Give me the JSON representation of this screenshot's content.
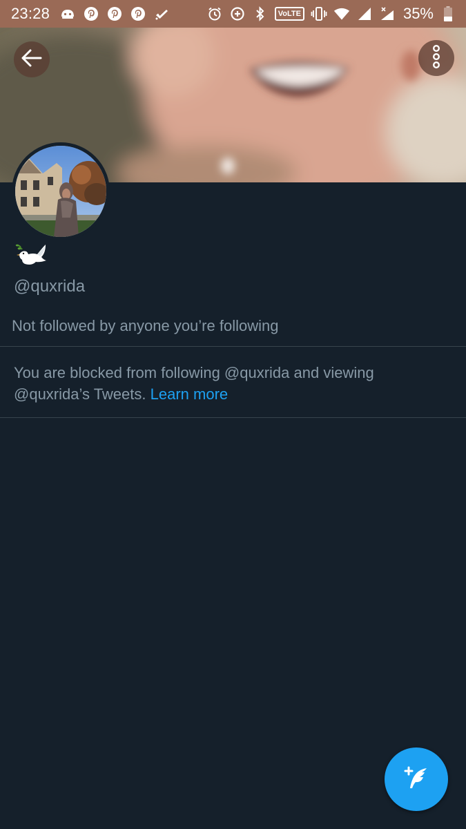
{
  "status_bar": {
    "time": "23:28",
    "left_icons": [
      "android-face-icon",
      "pinterest-icon",
      "pinterest-icon",
      "pinterest-icon",
      "check-icon"
    ],
    "right_icons": [
      "alarm-icon",
      "data-saver-icon",
      "bluetooth-icon",
      "volte-badge",
      "vibrate-icon",
      "wifi-icon",
      "signal-icon",
      "signal-no-data-icon",
      "battery-icon"
    ],
    "volte_label": "VoLTE",
    "battery_percent": "35%",
    "battery_level": 0.35,
    "color": "#9a6a56"
  },
  "header": {
    "back_icon": "arrow-left-icon",
    "more_icon": "more-vertical-icon"
  },
  "profile": {
    "display_name_emoji": "🕊️",
    "handle": "@quxrida",
    "followers_note": "Not followed by anyone you’re following",
    "blocked_text": "You are blocked from following @quxrida and viewing @quxrida’s Tweets.",
    "learn_more_label": "Learn more"
  },
  "fab": {
    "icon": "compose-tweet-icon",
    "color": "#1da1f2"
  },
  "theme": {
    "background": "#15202b",
    "secondary_text": "#8899a6",
    "accent": "#1da1f2",
    "divider": "#38444d"
  }
}
